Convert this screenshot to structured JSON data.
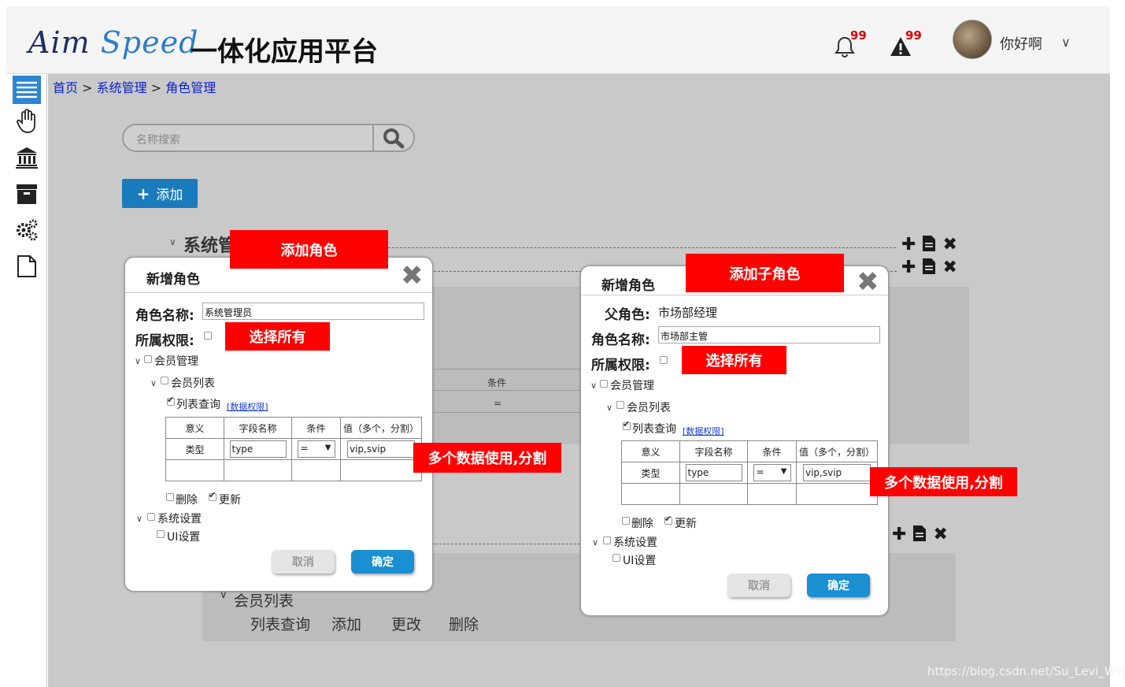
{
  "header": {
    "logo_a": "Aim",
    "logo_b": "Speed",
    "platform": "一体化应用平台",
    "notification_count": "99",
    "alert_count": "99",
    "username": "你好啊"
  },
  "breadcrumb": {
    "home": "首页",
    "sep": ">",
    "system": "系统管理",
    "roles": "角色管理"
  },
  "search": {
    "placeholder": "名称搜索"
  },
  "toolbar": {
    "add_label": "添加"
  },
  "tree": {
    "root_title": "系统管",
    "table_col_condition": "条件",
    "table_val_condition": "=",
    "member_list": "会员列表",
    "ops": [
      "列表查询",
      "添加",
      "更改",
      "删除"
    ]
  },
  "dialog1": {
    "title": "新增角色",
    "role_name_label": "角色名称:",
    "role_name_value": "系统管理员",
    "perm_label": "所属权限:",
    "member_mgmt": "会员管理",
    "member_list": "会员列表",
    "list_query": "列表查询",
    "data_perm": "[数据权限]",
    "table_headers": [
      "意义",
      "字段名称",
      "条件",
      "值（多个，分割）"
    ],
    "row_meaning": "类型",
    "row_field": "type",
    "row_cond": "=",
    "row_value": "vip,svip",
    "delete": "删除",
    "update": "更新",
    "sys_settings": "系统设置",
    "ui_settings": "UI设置",
    "cancel": "取消",
    "ok": "确定"
  },
  "dialog2": {
    "title": "新增角色",
    "parent_label": "父角色:",
    "parent_value": "市场部经理",
    "role_name_label": "角色名称:",
    "role_name_value": "市场部主管",
    "perm_label": "所属权限:",
    "member_mgmt": "会员管理",
    "member_list": "会员列表",
    "list_query": "列表查询",
    "data_perm": "[数据权限]",
    "table_headers": [
      "意义",
      "字段名称",
      "条件",
      "值（多个，分割）"
    ],
    "row_meaning": "类型",
    "row_field": "type",
    "row_cond": "=",
    "row_value": "vip,svip",
    "delete": "删除",
    "update": "更新",
    "sys_settings": "系统设置",
    "ui_settings": "UI设置",
    "cancel": "取消",
    "ok": "确定"
  },
  "annotations": {
    "add_role": "添加角色",
    "add_sub_role": "添加子角色",
    "select_all": "选择所有",
    "multi_data": "多个数据使用,分割"
  },
  "watermark": "https://blog.csdn.net/Su_Levi_Wei",
  "colors": {
    "accent": "#1a7bbd",
    "annotation": "#ff0000",
    "badge": "#e00000"
  }
}
